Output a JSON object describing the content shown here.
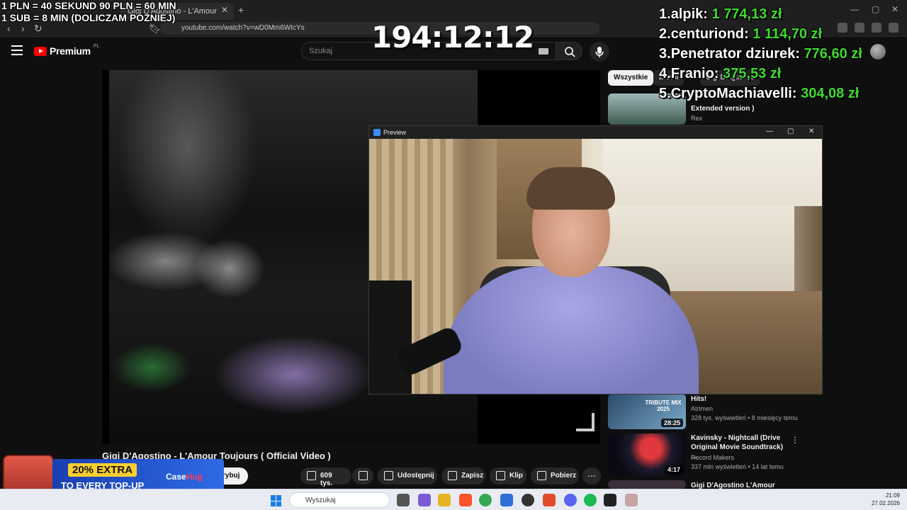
{
  "browser": {
    "tab_title": "Gigi D'Agostino - L'Amour",
    "url": "youtube.com/watch?v=wD0Mm6WIcYs"
  },
  "youtube": {
    "logo_text": "Premium",
    "logo_region": "PL",
    "search_placeholder": "Szukaj",
    "video_title": "Gigi D'Agostino - L'Amour Toujours ( Official Video )",
    "subscribe_label": "Subskrybuj",
    "subscribe_visible": "rybuj",
    "actions": {
      "likes": "609 tys.",
      "share": "Udostępnij",
      "save": "Zapisz",
      "clip": "Klip",
      "download": "Pobierz"
    },
    "chips": [
      "Wszystkie",
      "Z serii",
      "Gigi D'Agostino"
    ],
    "recommendations": [
      {
        "title": "Alex Jenkins - Better Off Alone ( Extended version )",
        "title_visible_line2": "Extended version )",
        "channel": "Rex"
      },
      {
        "title": "Hits!",
        "channel": "Atrimen",
        "meta": "328 tys. wyświetleń • 8 miesięcy temu",
        "thumb_label": "TRIBUTE MIX 2025",
        "duration": "28:25"
      },
      {
        "title": "Kavinsky - Nightcall (Drive Original Movie Soundtrack) ...",
        "channel": "Record Makers",
        "meta": "337 mln wyświetleń • 14 lat temu",
        "duration": "4:17"
      },
      {
        "title": "Gigi D'Agostino L'Amour"
      }
    ]
  },
  "preview_window": {
    "title": "Preview"
  },
  "overlay": {
    "line1": "1 PLN = 40 SEKUND 90 PLN = 60 MIN",
    "line2": "1 SUB = 8 MIN (DOLICZAM PÓŹNIEJ)",
    "timer": "194:12:12",
    "leaderboard": [
      {
        "rank": "1.",
        "name": "alpik:",
        "amount": "1 774,13 zł"
      },
      {
        "rank": "2.",
        "name": "centuriond:",
        "amount": "1 114,70 zł"
      },
      {
        "rank": "3.",
        "name": "Penetrator dziurek:",
        "amount": "776,60 zł"
      },
      {
        "rank": "4.",
        "name": "Franio:",
        "amount": "375,53 zł"
      },
      {
        "rank": "5.",
        "name": "CryptoMachiavelli:",
        "amount": "304,08 zł"
      }
    ]
  },
  "ad": {
    "line1": "20% EXTRA",
    "line2": "TO EVERY TOP-UP",
    "brand_a": "Case",
    "brand_b": "Hug"
  },
  "taskbar": {
    "search_label": "Wyszukaj",
    "time": "21:09",
    "date": "27.02.2026"
  },
  "colors": {
    "youtube_red": "#ff0000",
    "leaderboard_green": "#3ddc2e",
    "page_bg": "#0f0f0f"
  }
}
